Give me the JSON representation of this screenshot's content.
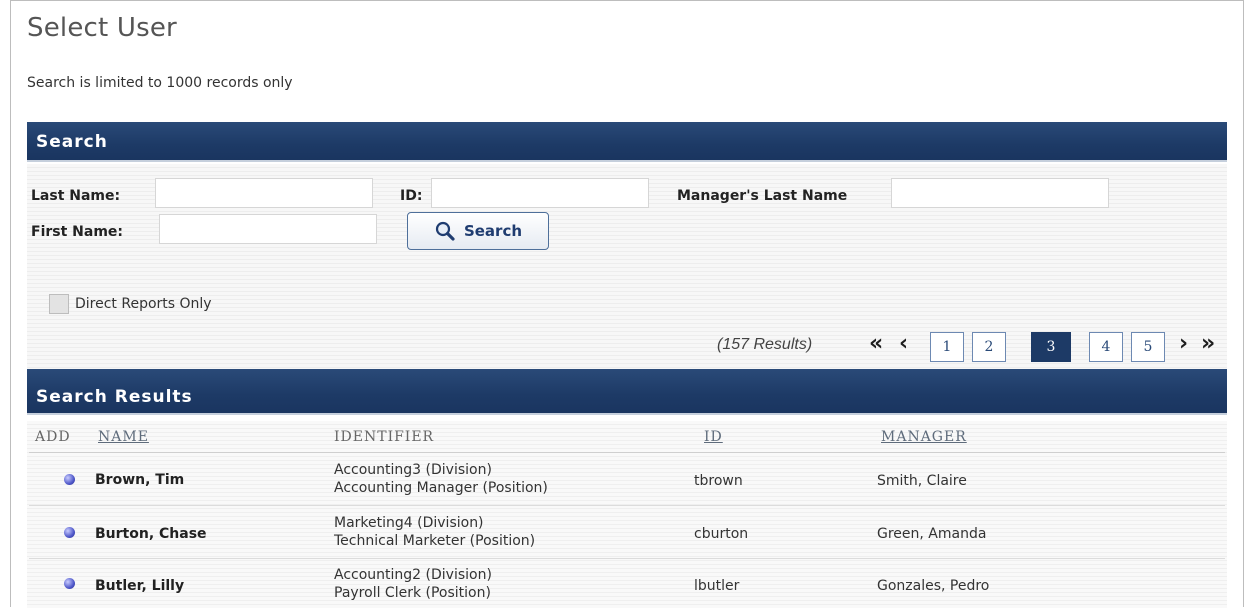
{
  "page": {
    "title": "Select User",
    "limit_note": "Search is limited to 1000 records only"
  },
  "search": {
    "section_title": "Search",
    "last_name_label": "Last Name:",
    "id_label": "ID:",
    "manager_last_name_label": "Manager's Last Name",
    "first_name_label": "First Name:",
    "last_name_value": "",
    "id_value": "",
    "manager_last_name_value": "",
    "first_name_value": "",
    "button_label": "Search",
    "button_icon": "magnifier-icon",
    "direct_reports_label": "Direct Reports Only",
    "direct_reports_checked": false
  },
  "pagination": {
    "results_text": "(157 Results)",
    "first_glyph": "«",
    "prev_glyph": "‹",
    "next_glyph": "›",
    "last_glyph": "»",
    "pages": [
      "1",
      "2",
      "3",
      "4",
      "5"
    ],
    "current_page": "3"
  },
  "results": {
    "section_title": "Search Results",
    "columns": {
      "add": "ADD",
      "name": "NAME",
      "identifier": "IDENTIFIER",
      "id": "ID",
      "manager": "MANAGER"
    },
    "rows": [
      {
        "name": "Brown, Tim",
        "identifier_line1": "Accounting3 (Division)",
        "identifier_line2": "Accounting Manager (Position)",
        "id": "tbrown",
        "manager": "Smith, Claire"
      },
      {
        "name": "Burton, Chase",
        "identifier_line1": "Marketing4 (Division)",
        "identifier_line2": "Technical Marketer (Position)",
        "id": "cburton",
        "manager": "Green, Amanda"
      },
      {
        "name": "Butler, Lilly",
        "identifier_line1": "Accounting2 (Division)",
        "identifier_line2": "Payroll Clerk (Position)",
        "id": "lbutler",
        "manager": "Gonzales, Pedro"
      }
    ]
  },
  "colors": {
    "section_bar": "#1d3a66",
    "active_page": "#1d3a66",
    "add_dot": "#4e57c9"
  }
}
